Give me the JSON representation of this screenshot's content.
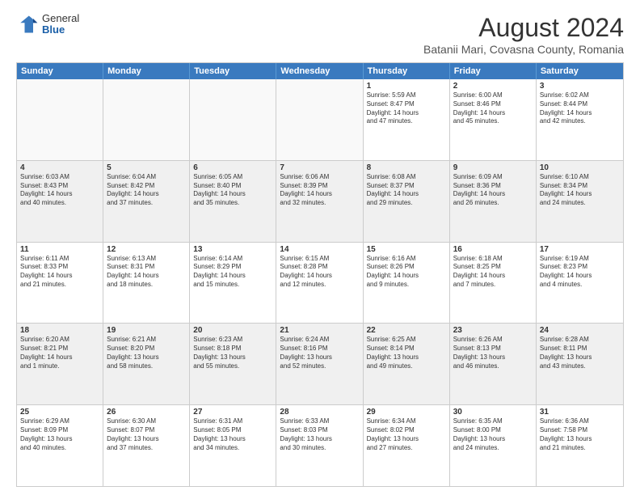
{
  "logo": {
    "general": "General",
    "blue": "Blue"
  },
  "title": "August 2024",
  "subtitle": "Batanii Mari, Covasna County, Romania",
  "days": [
    "Sunday",
    "Monday",
    "Tuesday",
    "Wednesday",
    "Thursday",
    "Friday",
    "Saturday"
  ],
  "rows": [
    [
      {
        "day": "",
        "lines": []
      },
      {
        "day": "",
        "lines": []
      },
      {
        "day": "",
        "lines": []
      },
      {
        "day": "",
        "lines": []
      },
      {
        "day": "1",
        "lines": [
          "Sunrise: 5:59 AM",
          "Sunset: 8:47 PM",
          "Daylight: 14 hours",
          "and 47 minutes."
        ]
      },
      {
        "day": "2",
        "lines": [
          "Sunrise: 6:00 AM",
          "Sunset: 8:46 PM",
          "Daylight: 14 hours",
          "and 45 minutes."
        ]
      },
      {
        "day": "3",
        "lines": [
          "Sunrise: 6:02 AM",
          "Sunset: 8:44 PM",
          "Daylight: 14 hours",
          "and 42 minutes."
        ]
      }
    ],
    [
      {
        "day": "4",
        "lines": [
          "Sunrise: 6:03 AM",
          "Sunset: 8:43 PM",
          "Daylight: 14 hours",
          "and 40 minutes."
        ]
      },
      {
        "day": "5",
        "lines": [
          "Sunrise: 6:04 AM",
          "Sunset: 8:42 PM",
          "Daylight: 14 hours",
          "and 37 minutes."
        ]
      },
      {
        "day": "6",
        "lines": [
          "Sunrise: 6:05 AM",
          "Sunset: 8:40 PM",
          "Daylight: 14 hours",
          "and 35 minutes."
        ]
      },
      {
        "day": "7",
        "lines": [
          "Sunrise: 6:06 AM",
          "Sunset: 8:39 PM",
          "Daylight: 14 hours",
          "and 32 minutes."
        ]
      },
      {
        "day": "8",
        "lines": [
          "Sunrise: 6:08 AM",
          "Sunset: 8:37 PM",
          "Daylight: 14 hours",
          "and 29 minutes."
        ]
      },
      {
        "day": "9",
        "lines": [
          "Sunrise: 6:09 AM",
          "Sunset: 8:36 PM",
          "Daylight: 14 hours",
          "and 26 minutes."
        ]
      },
      {
        "day": "10",
        "lines": [
          "Sunrise: 6:10 AM",
          "Sunset: 8:34 PM",
          "Daylight: 14 hours",
          "and 24 minutes."
        ]
      }
    ],
    [
      {
        "day": "11",
        "lines": [
          "Sunrise: 6:11 AM",
          "Sunset: 8:33 PM",
          "Daylight: 14 hours",
          "and 21 minutes."
        ]
      },
      {
        "day": "12",
        "lines": [
          "Sunrise: 6:13 AM",
          "Sunset: 8:31 PM",
          "Daylight: 14 hours",
          "and 18 minutes."
        ]
      },
      {
        "day": "13",
        "lines": [
          "Sunrise: 6:14 AM",
          "Sunset: 8:29 PM",
          "Daylight: 14 hours",
          "and 15 minutes."
        ]
      },
      {
        "day": "14",
        "lines": [
          "Sunrise: 6:15 AM",
          "Sunset: 8:28 PM",
          "Daylight: 14 hours",
          "and 12 minutes."
        ]
      },
      {
        "day": "15",
        "lines": [
          "Sunrise: 6:16 AM",
          "Sunset: 8:26 PM",
          "Daylight: 14 hours",
          "and 9 minutes."
        ]
      },
      {
        "day": "16",
        "lines": [
          "Sunrise: 6:18 AM",
          "Sunset: 8:25 PM",
          "Daylight: 14 hours",
          "and 7 minutes."
        ]
      },
      {
        "day": "17",
        "lines": [
          "Sunrise: 6:19 AM",
          "Sunset: 8:23 PM",
          "Daylight: 14 hours",
          "and 4 minutes."
        ]
      }
    ],
    [
      {
        "day": "18",
        "lines": [
          "Sunrise: 6:20 AM",
          "Sunset: 8:21 PM",
          "Daylight: 14 hours",
          "and 1 minute."
        ]
      },
      {
        "day": "19",
        "lines": [
          "Sunrise: 6:21 AM",
          "Sunset: 8:20 PM",
          "Daylight: 13 hours",
          "and 58 minutes."
        ]
      },
      {
        "day": "20",
        "lines": [
          "Sunrise: 6:23 AM",
          "Sunset: 8:18 PM",
          "Daylight: 13 hours",
          "and 55 minutes."
        ]
      },
      {
        "day": "21",
        "lines": [
          "Sunrise: 6:24 AM",
          "Sunset: 8:16 PM",
          "Daylight: 13 hours",
          "and 52 minutes."
        ]
      },
      {
        "day": "22",
        "lines": [
          "Sunrise: 6:25 AM",
          "Sunset: 8:14 PM",
          "Daylight: 13 hours",
          "and 49 minutes."
        ]
      },
      {
        "day": "23",
        "lines": [
          "Sunrise: 6:26 AM",
          "Sunset: 8:13 PM",
          "Daylight: 13 hours",
          "and 46 minutes."
        ]
      },
      {
        "day": "24",
        "lines": [
          "Sunrise: 6:28 AM",
          "Sunset: 8:11 PM",
          "Daylight: 13 hours",
          "and 43 minutes."
        ]
      }
    ],
    [
      {
        "day": "25",
        "lines": [
          "Sunrise: 6:29 AM",
          "Sunset: 8:09 PM",
          "Daylight: 13 hours",
          "and 40 minutes."
        ]
      },
      {
        "day": "26",
        "lines": [
          "Sunrise: 6:30 AM",
          "Sunset: 8:07 PM",
          "Daylight: 13 hours",
          "and 37 minutes."
        ]
      },
      {
        "day": "27",
        "lines": [
          "Sunrise: 6:31 AM",
          "Sunset: 8:05 PM",
          "Daylight: 13 hours",
          "and 34 minutes."
        ]
      },
      {
        "day": "28",
        "lines": [
          "Sunrise: 6:33 AM",
          "Sunset: 8:03 PM",
          "Daylight: 13 hours",
          "and 30 minutes."
        ]
      },
      {
        "day": "29",
        "lines": [
          "Sunrise: 6:34 AM",
          "Sunset: 8:02 PM",
          "Daylight: 13 hours",
          "and 27 minutes."
        ]
      },
      {
        "day": "30",
        "lines": [
          "Sunrise: 6:35 AM",
          "Sunset: 8:00 PM",
          "Daylight: 13 hours",
          "and 24 minutes."
        ]
      },
      {
        "day": "31",
        "lines": [
          "Sunrise: 6:36 AM",
          "Sunset: 7:58 PM",
          "Daylight: 13 hours",
          "and 21 minutes."
        ]
      }
    ]
  ],
  "shaded_rows": [
    1,
    3
  ],
  "colors": {
    "header_bg": "#3a7abf",
    "header_text": "#ffffff",
    "cell_shaded": "#f0f0f0",
    "cell_normal": "#ffffff"
  }
}
